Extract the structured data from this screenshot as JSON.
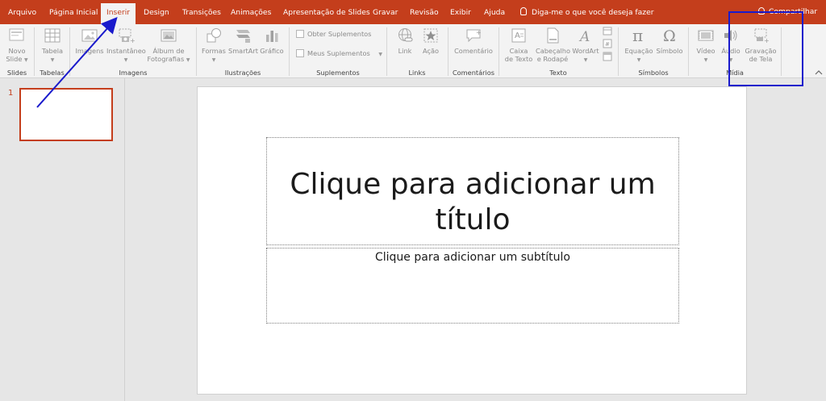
{
  "tabs": {
    "arquivo": "Arquivo",
    "pagina_inicial": "Página Inicial",
    "inserir": "Inserir",
    "design": "Design",
    "transicoes": "Transições",
    "animacoes": "Animações",
    "apresentacao": "Apresentação de Slides",
    "gravar": "Gravar",
    "revisao": "Revisão",
    "exibir": "Exibir",
    "ajuda": "Ajuda"
  },
  "tell_me": "Diga-me o que você deseja fazer",
  "share": "Compartilhar",
  "ribbon": {
    "novo_slide_1": "Novo",
    "novo_slide_2": "Slide",
    "tabela": "Tabela",
    "imagens": "Imagens",
    "instantaneo": "Instantâneo",
    "album_1": "Álbum de",
    "album_2": "Fotografias",
    "formas": "Formas",
    "smartart": "SmartArt",
    "grafico": "Gráfico",
    "obter_suplementos": "Obter Suplementos",
    "meus_suplementos": "Meus Suplementos",
    "link": "Link",
    "acao": "Ação",
    "comentario": "Comentário",
    "caixa_1": "Caixa",
    "caixa_2": "de Texto",
    "cabecalho_1": "Cabeçalho",
    "cabecalho_2": "e Rodapé",
    "wordart": "WordArt",
    "equacao": "Equação",
    "simbolo": "Símbolo",
    "video": "Vídeo",
    "audio": "Áudio",
    "gravacao_1": "Gravação",
    "gravacao_2": "de Tela"
  },
  "groups": {
    "slides": "Slides",
    "tabelas": "Tabelas",
    "imagens": "Imagens",
    "ilustracoes": "Ilustrações",
    "suplementos": "Suplementos",
    "links": "Links",
    "comentarios": "Comentários",
    "texto": "Texto",
    "simbolos": "Símbolos",
    "midia": "Mídia"
  },
  "thumbnail": {
    "number": "1"
  },
  "slide": {
    "title_placeholder": "Clique para adicionar um título",
    "subtitle_placeholder": "Clique para adicionar um subtítulo"
  },
  "colors": {
    "accent": "#c43e1c",
    "annotation": "#1a1acc"
  }
}
